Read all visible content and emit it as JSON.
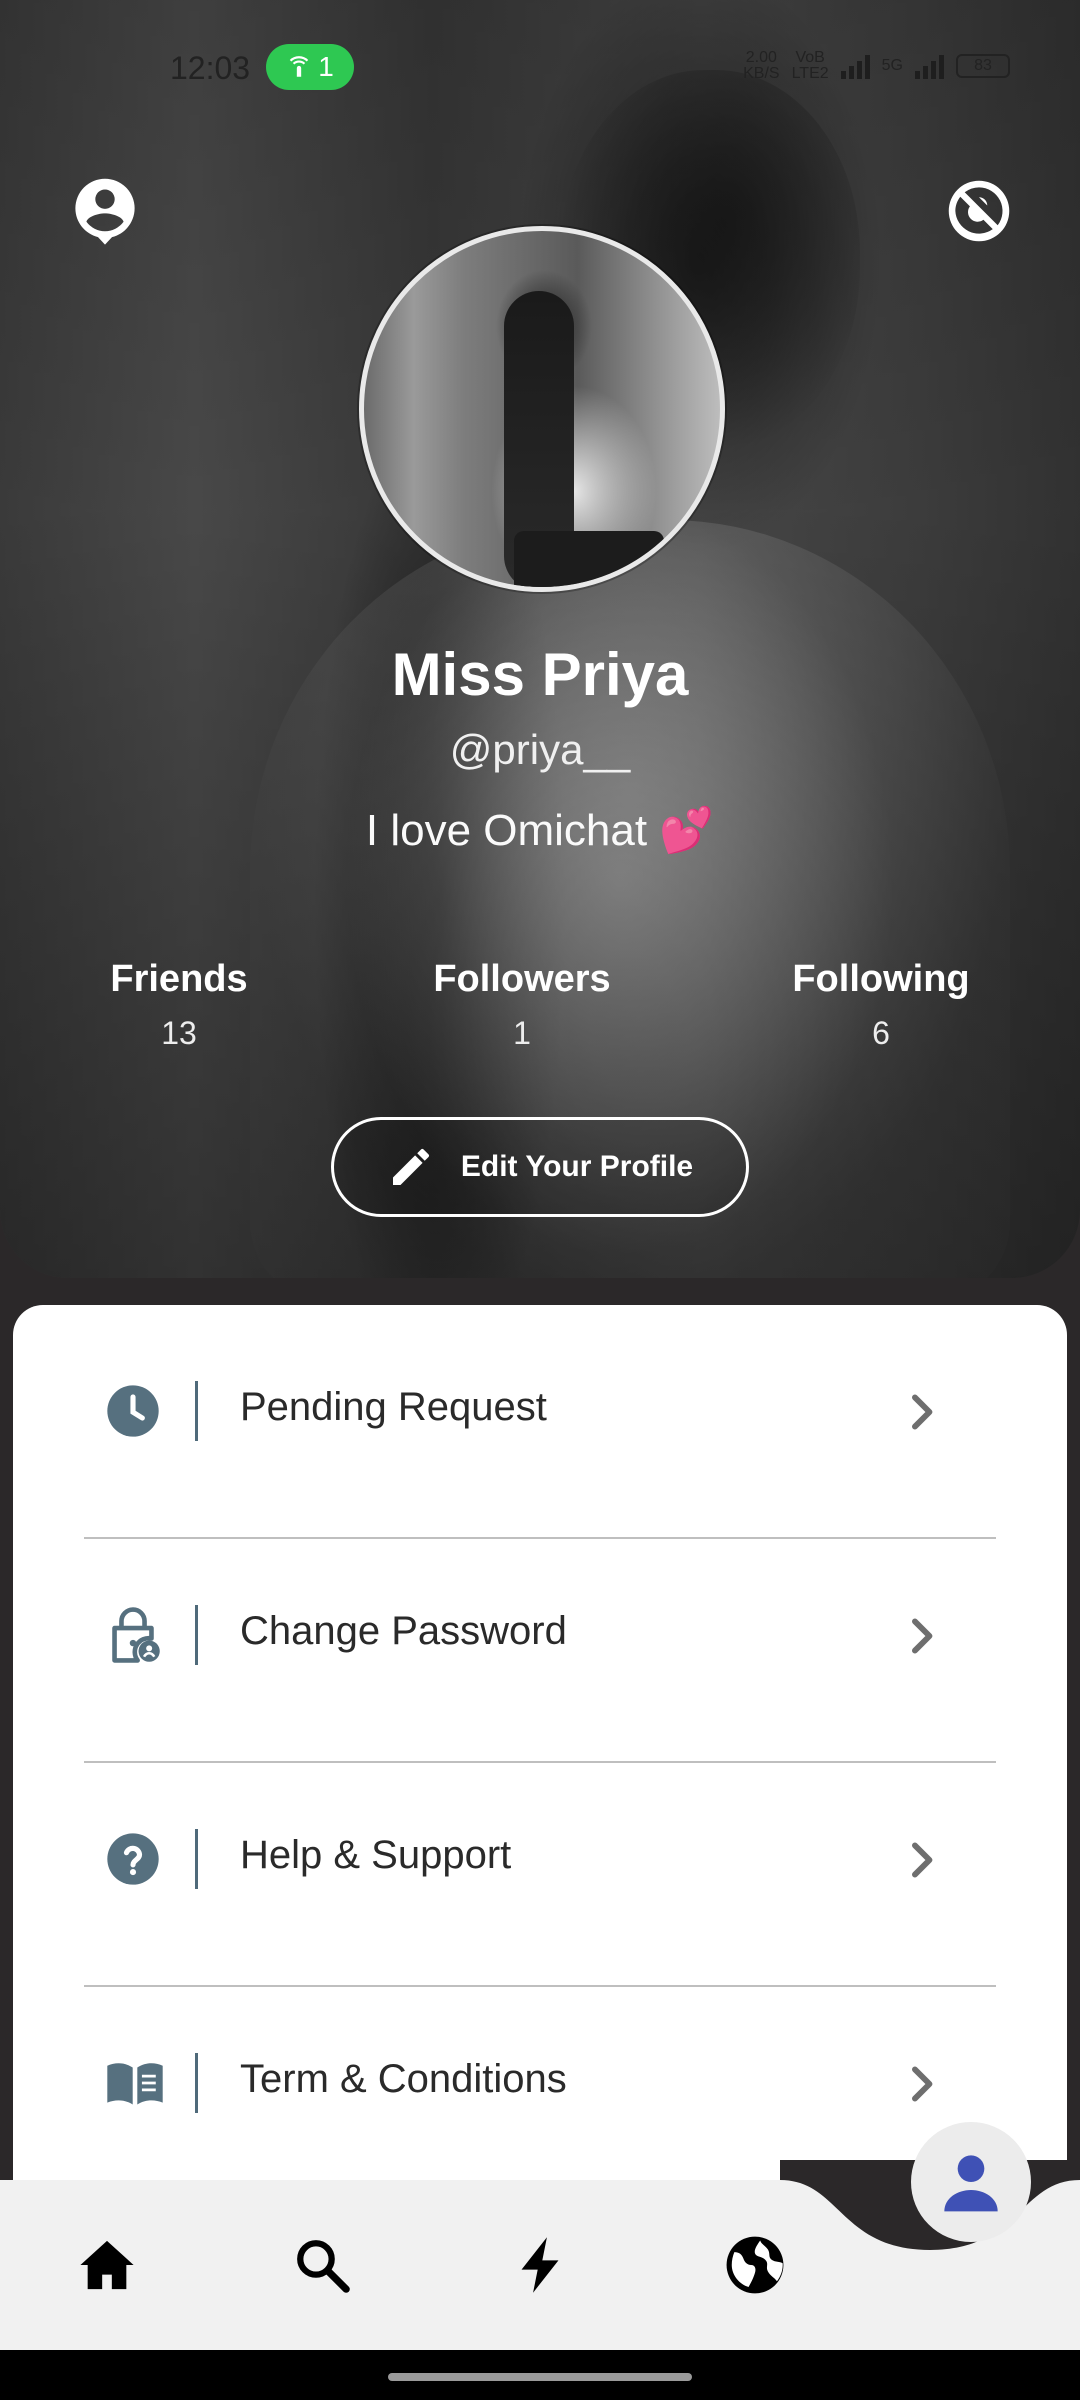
{
  "status_bar": {
    "time": "12:03",
    "hotspot_count": "1",
    "net_speed_value": "2.00",
    "net_speed_unit": "KB/S",
    "volte_top": "VoB",
    "volte_bottom": "LTE2",
    "network_5g": "5G",
    "battery": "83"
  },
  "profile": {
    "name": "Miss Priya",
    "handle": "@priya__",
    "bio": "I love Omichat 💕"
  },
  "stats": [
    {
      "label": "Friends",
      "value": "13"
    },
    {
      "label": "Followers",
      "value": "1"
    },
    {
      "label": "Following",
      "value": "6"
    }
  ],
  "edit_profile_label": "Edit Your Profile",
  "menu": [
    {
      "label": "Pending Request",
      "icon": "clock-icon"
    },
    {
      "label": "Change Password",
      "icon": "lock-person-icon"
    },
    {
      "label": "Help & Support",
      "icon": "help-icon"
    },
    {
      "label": "Term & Conditions",
      "icon": "book-icon"
    }
  ],
  "bottom_nav": [
    "home-icon",
    "search-icon",
    "flash-icon",
    "globe-icon",
    "person-icon"
  ],
  "colors": {
    "menu_icon": "#56707f",
    "fab_icon": "#3f51b5",
    "hotspot_pill": "#2ec852"
  }
}
